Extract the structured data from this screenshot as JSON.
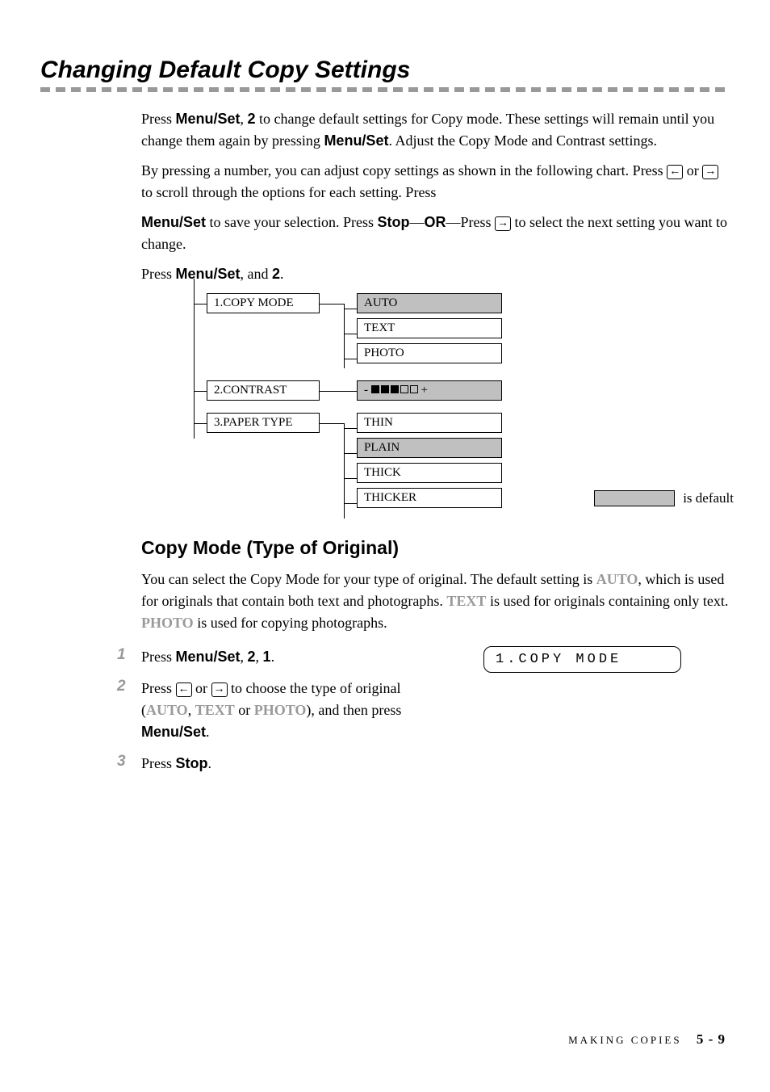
{
  "main_heading": "Changing Default Copy Settings",
  "intro": {
    "part1": "Press ",
    "bold1": "Menu/Set",
    "part2": ", ",
    "bold2": "2",
    "part3": " to change default settings for Copy mode. These settings will remain until you change them again by pressing ",
    "bold3": "Menu/Set",
    "part4": ". Adjust the Copy Mode and Contrast settings."
  },
  "para2": {
    "part1": "By pressing a number, you can adjust copy settings as shown in the following chart. Press ",
    "part2": " or ",
    "part3": " to scroll through the options for each setting. Press"
  },
  "para3": {
    "bold1": "Menu/Set",
    "part1": " to save your selection. Press ",
    "bold2": "Stop",
    "part2": "—",
    "bold3": "OR",
    "part3": "—Press ",
    "part4": " to select the next setting you want to change."
  },
  "press_line": {
    "part1": "Press ",
    "bold1": "Menu/Set",
    "part2": ", and ",
    "bold2": "2",
    "part3": "."
  },
  "tree": {
    "item1": {
      "label": "1.COPY MODE",
      "options": [
        "AUTO",
        "TEXT",
        "PHOTO"
      ],
      "default_index": 0
    },
    "item2": {
      "label": "2.CONTRAST",
      "contrast_prefix": "- ",
      "contrast_suffix": " +"
    },
    "item3": {
      "label": "3.PAPER TYPE",
      "options": [
        "THIN",
        "PLAIN",
        "THICK",
        "THICKER"
      ],
      "default_index": 1
    }
  },
  "legend": "is default",
  "sub_heading": "Copy Mode (Type of Original)",
  "copy_mode_para": {
    "part1": "You can select the Copy Mode for your type of original. The default setting is ",
    "gray1": "AUTO",
    "part2": ", which is used for originals that contain both text and photographs. ",
    "gray2": "TEXT",
    "part3": " is used for originals containing only text. ",
    "gray3": "PHOTO",
    "part4": " is used for copying photographs."
  },
  "steps": {
    "s1": {
      "num": "1",
      "part1": "Press ",
      "bold1": "Menu/Set",
      "part2": ", ",
      "bold2": "2",
      "part3": ", ",
      "bold3": "1",
      "part4": "."
    },
    "s2": {
      "num": "2",
      "part1": "Press ",
      "part2": " or ",
      "part3": " to choose the type of original (",
      "gray1": "AUTO",
      "part4": ", ",
      "gray2": "TEXT",
      "part5": " or ",
      "gray3": "PHOTO",
      "part6": "), and then press ",
      "bold1": "Menu/Set",
      "part7": "."
    },
    "s3": {
      "num": "3",
      "part1": "Press ",
      "bold1": "Stop",
      "part2": "."
    }
  },
  "lcd": "1.COPY MODE",
  "footer": {
    "section": "MAKING COPIES",
    "page": "5 - 9"
  },
  "arrows": {
    "left": "←",
    "right": "→"
  }
}
